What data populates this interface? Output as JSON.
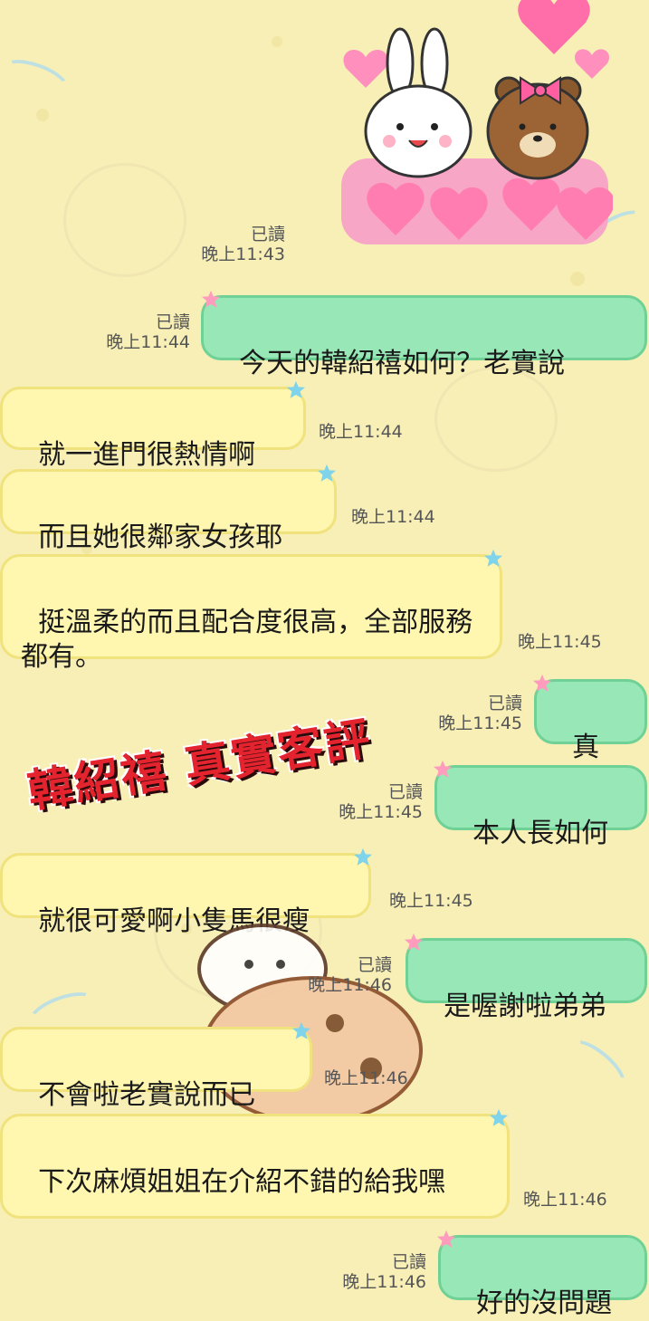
{
  "overlay_title": "韓紹禧 真實客評",
  "read_label": "已讀",
  "messages": [
    {
      "text": "今天的韓紹禧如何？老實說",
      "time": "晚上11:44"
    },
    {
      "text": "就一進門很熱情啊",
      "time": "晚上11:44"
    },
    {
      "text": "而且她很鄰家女孩耶",
      "time": "晚上11:44"
    },
    {
      "text": "挺溫柔的而且配合度很高，全部服務都有。",
      "time": "晚上11:45"
    },
    {
      "text": "真假",
      "time": "晚上11:45"
    },
    {
      "text": "本人長如何",
      "time": "晚上11:45"
    },
    {
      "text": "就很可愛啊小隻馬很瘦",
      "time": "晚上11:45"
    },
    {
      "text": "是喔謝啦弟弟",
      "time": "晚上11:46"
    },
    {
      "text": "不會啦老實說而已",
      "time": "晚上11:46"
    },
    {
      "text": "下次麻煩姐姐在介紹不錯的給我嘿",
      "time": "晚上11:46"
    },
    {
      "text": "好的沒問題",
      "time": "晚上11:46"
    }
  ],
  "sticker": {
    "name": "bunny-and-bear-hearts-sticker",
    "time": "晚上11:43"
  },
  "colors": {
    "background": "#f7efb6",
    "incoming_bubble": "#fff6b0",
    "outgoing_bubble": "#98e8b7",
    "overlay_text": "#e3232e"
  }
}
